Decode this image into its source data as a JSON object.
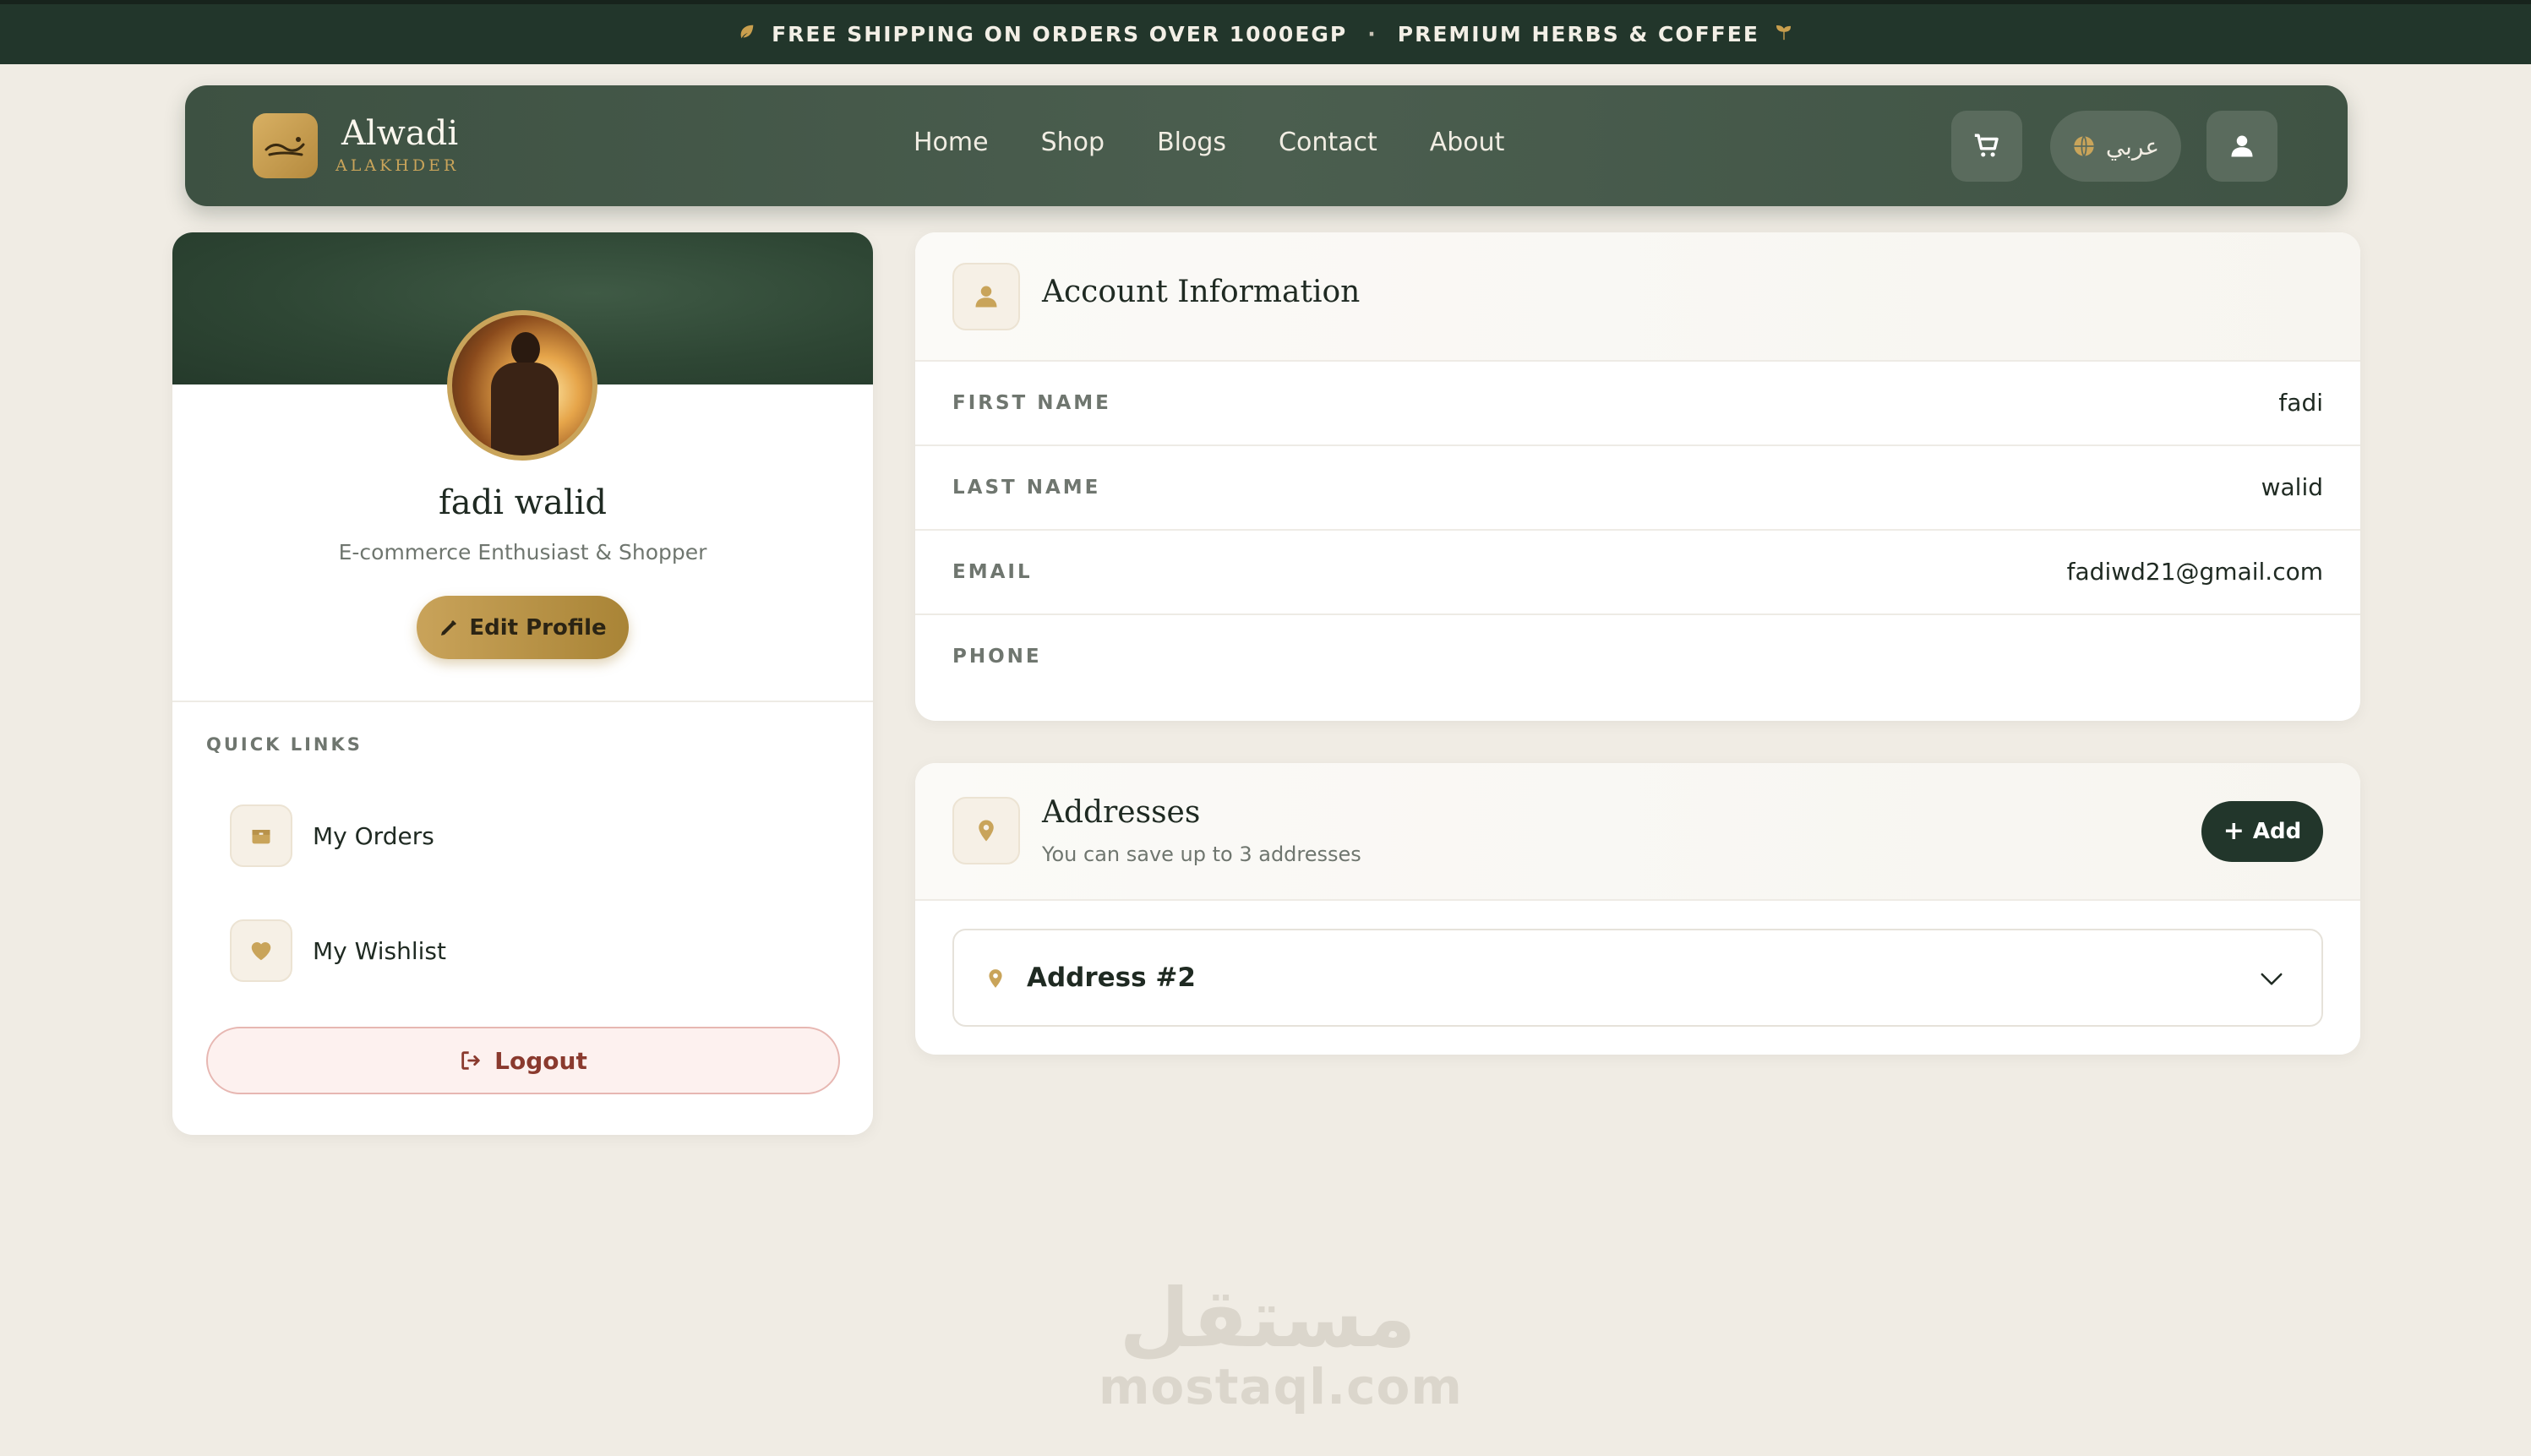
{
  "announcement": {
    "left_text": "FREE SHIPPING ON ORDERS OVER 1000EGP",
    "separator": "·",
    "right_text": "PREMIUM HERBS & COFFEE"
  },
  "brand": {
    "name": "Alwadi",
    "subtitle": "ALAKHDER"
  },
  "nav": {
    "links": [
      "Home",
      "Shop",
      "Blogs",
      "Contact",
      "About"
    ],
    "language_label": "عربي"
  },
  "profile": {
    "name": "fadi walid",
    "role": "E-commerce Enthusiast & Shopper",
    "edit_label": "Edit Profile",
    "quick_links_title": "QUICK LINKS",
    "quick_links": [
      "My Orders",
      "My Wishlist"
    ],
    "logout_label": "Logout"
  },
  "account": {
    "title": "Account Information",
    "fields": [
      {
        "label": "FIRST NAME",
        "value": "fadi"
      },
      {
        "label": "LAST NAME",
        "value": "walid"
      },
      {
        "label": "EMAIL",
        "value": "fadiwd21@gmail.com"
      },
      {
        "label": "PHONE",
        "value": ""
      }
    ]
  },
  "addresses": {
    "title": "Addresses",
    "subtitle": "You can save up to 3 addresses",
    "add_label": "Add",
    "items": [
      "Address #2"
    ]
  },
  "watermark": {
    "arabic": "مستقل",
    "latin": "mostaql.com"
  },
  "colors": {
    "primary_dark": "#22362b",
    "accent_gold": "#c9a45a",
    "background": "#f0ece4"
  }
}
